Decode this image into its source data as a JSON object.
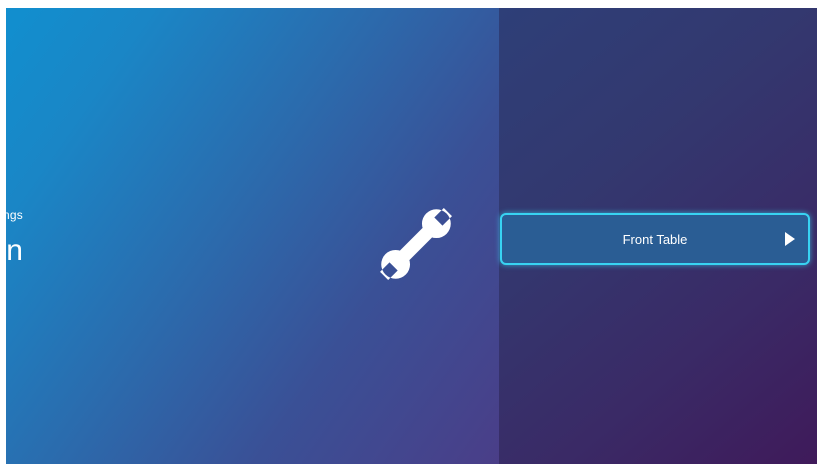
{
  "header": {
    "subtitle": "Settings",
    "title": "Installation"
  },
  "menu": {
    "items": [
      {
        "label": "Front Table",
        "icon": "play-arrow-icon",
        "selected": true
      }
    ]
  },
  "icons": {
    "category": "wrench-icon"
  },
  "colors": {
    "focus_border": "#38d3f2",
    "item_fill": "#2a5d94"
  }
}
